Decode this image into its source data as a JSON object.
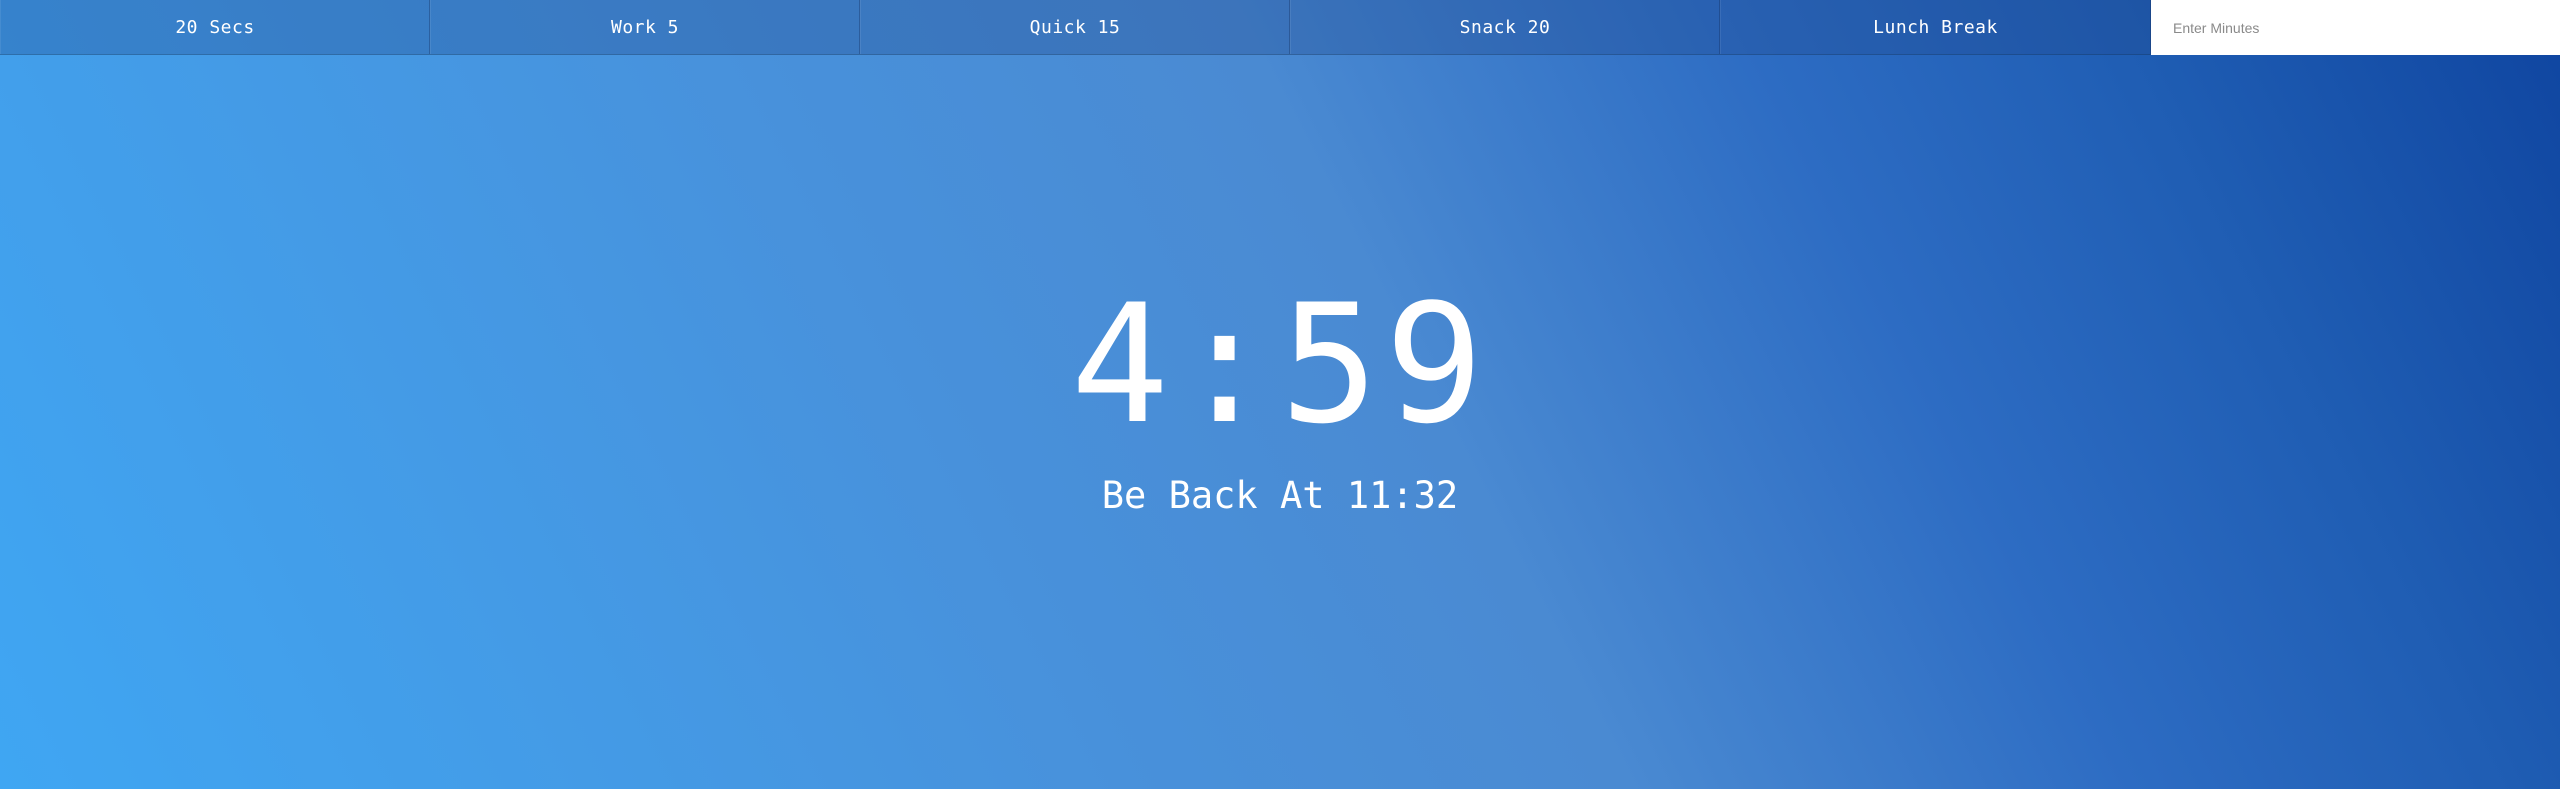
{
  "timer_buttons": [
    {
      "label": "20 Secs"
    },
    {
      "label": "Work 5"
    },
    {
      "label": "Quick 15"
    },
    {
      "label": "Snack 20"
    },
    {
      "label": "Lunch Break"
    }
  ],
  "custom_minutes": {
    "placeholder": "Enter Minutes",
    "value": ""
  },
  "display": {
    "time_left": "4:59",
    "end_time": "Be Back At 11:32"
  },
  "colors": {
    "gradient_start": "#3fa6f3",
    "gradient_end": "#0f45a0",
    "text": "#ffffff"
  }
}
